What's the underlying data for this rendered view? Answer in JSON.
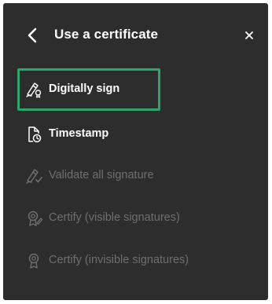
{
  "panel": {
    "title": "Use a certificate",
    "back_icon": "chevron-left-icon",
    "close_icon": "close-icon"
  },
  "items": [
    {
      "label": "Digitally sign",
      "icon": "sign-pen-icon",
      "enabled": true,
      "focused": true
    },
    {
      "label": "Timestamp",
      "icon": "timestamp-document-icon",
      "enabled": true,
      "focused": false
    },
    {
      "label": "Validate all signature",
      "icon": "validate-signature-icon",
      "enabled": false,
      "focused": false
    },
    {
      "label": "Certify (visible signatures)",
      "icon": "certify-visible-icon",
      "enabled": false,
      "focused": false
    },
    {
      "label": "Certify (invisible signatures)",
      "icon": "certify-invisible-icon",
      "enabled": false,
      "focused": false
    }
  ],
  "colors": {
    "panel_bg": "#2d2d2d",
    "text_enabled": "#ffffff",
    "text_disabled": "#6f6f6f",
    "focus_ring": "#2ea56a"
  }
}
